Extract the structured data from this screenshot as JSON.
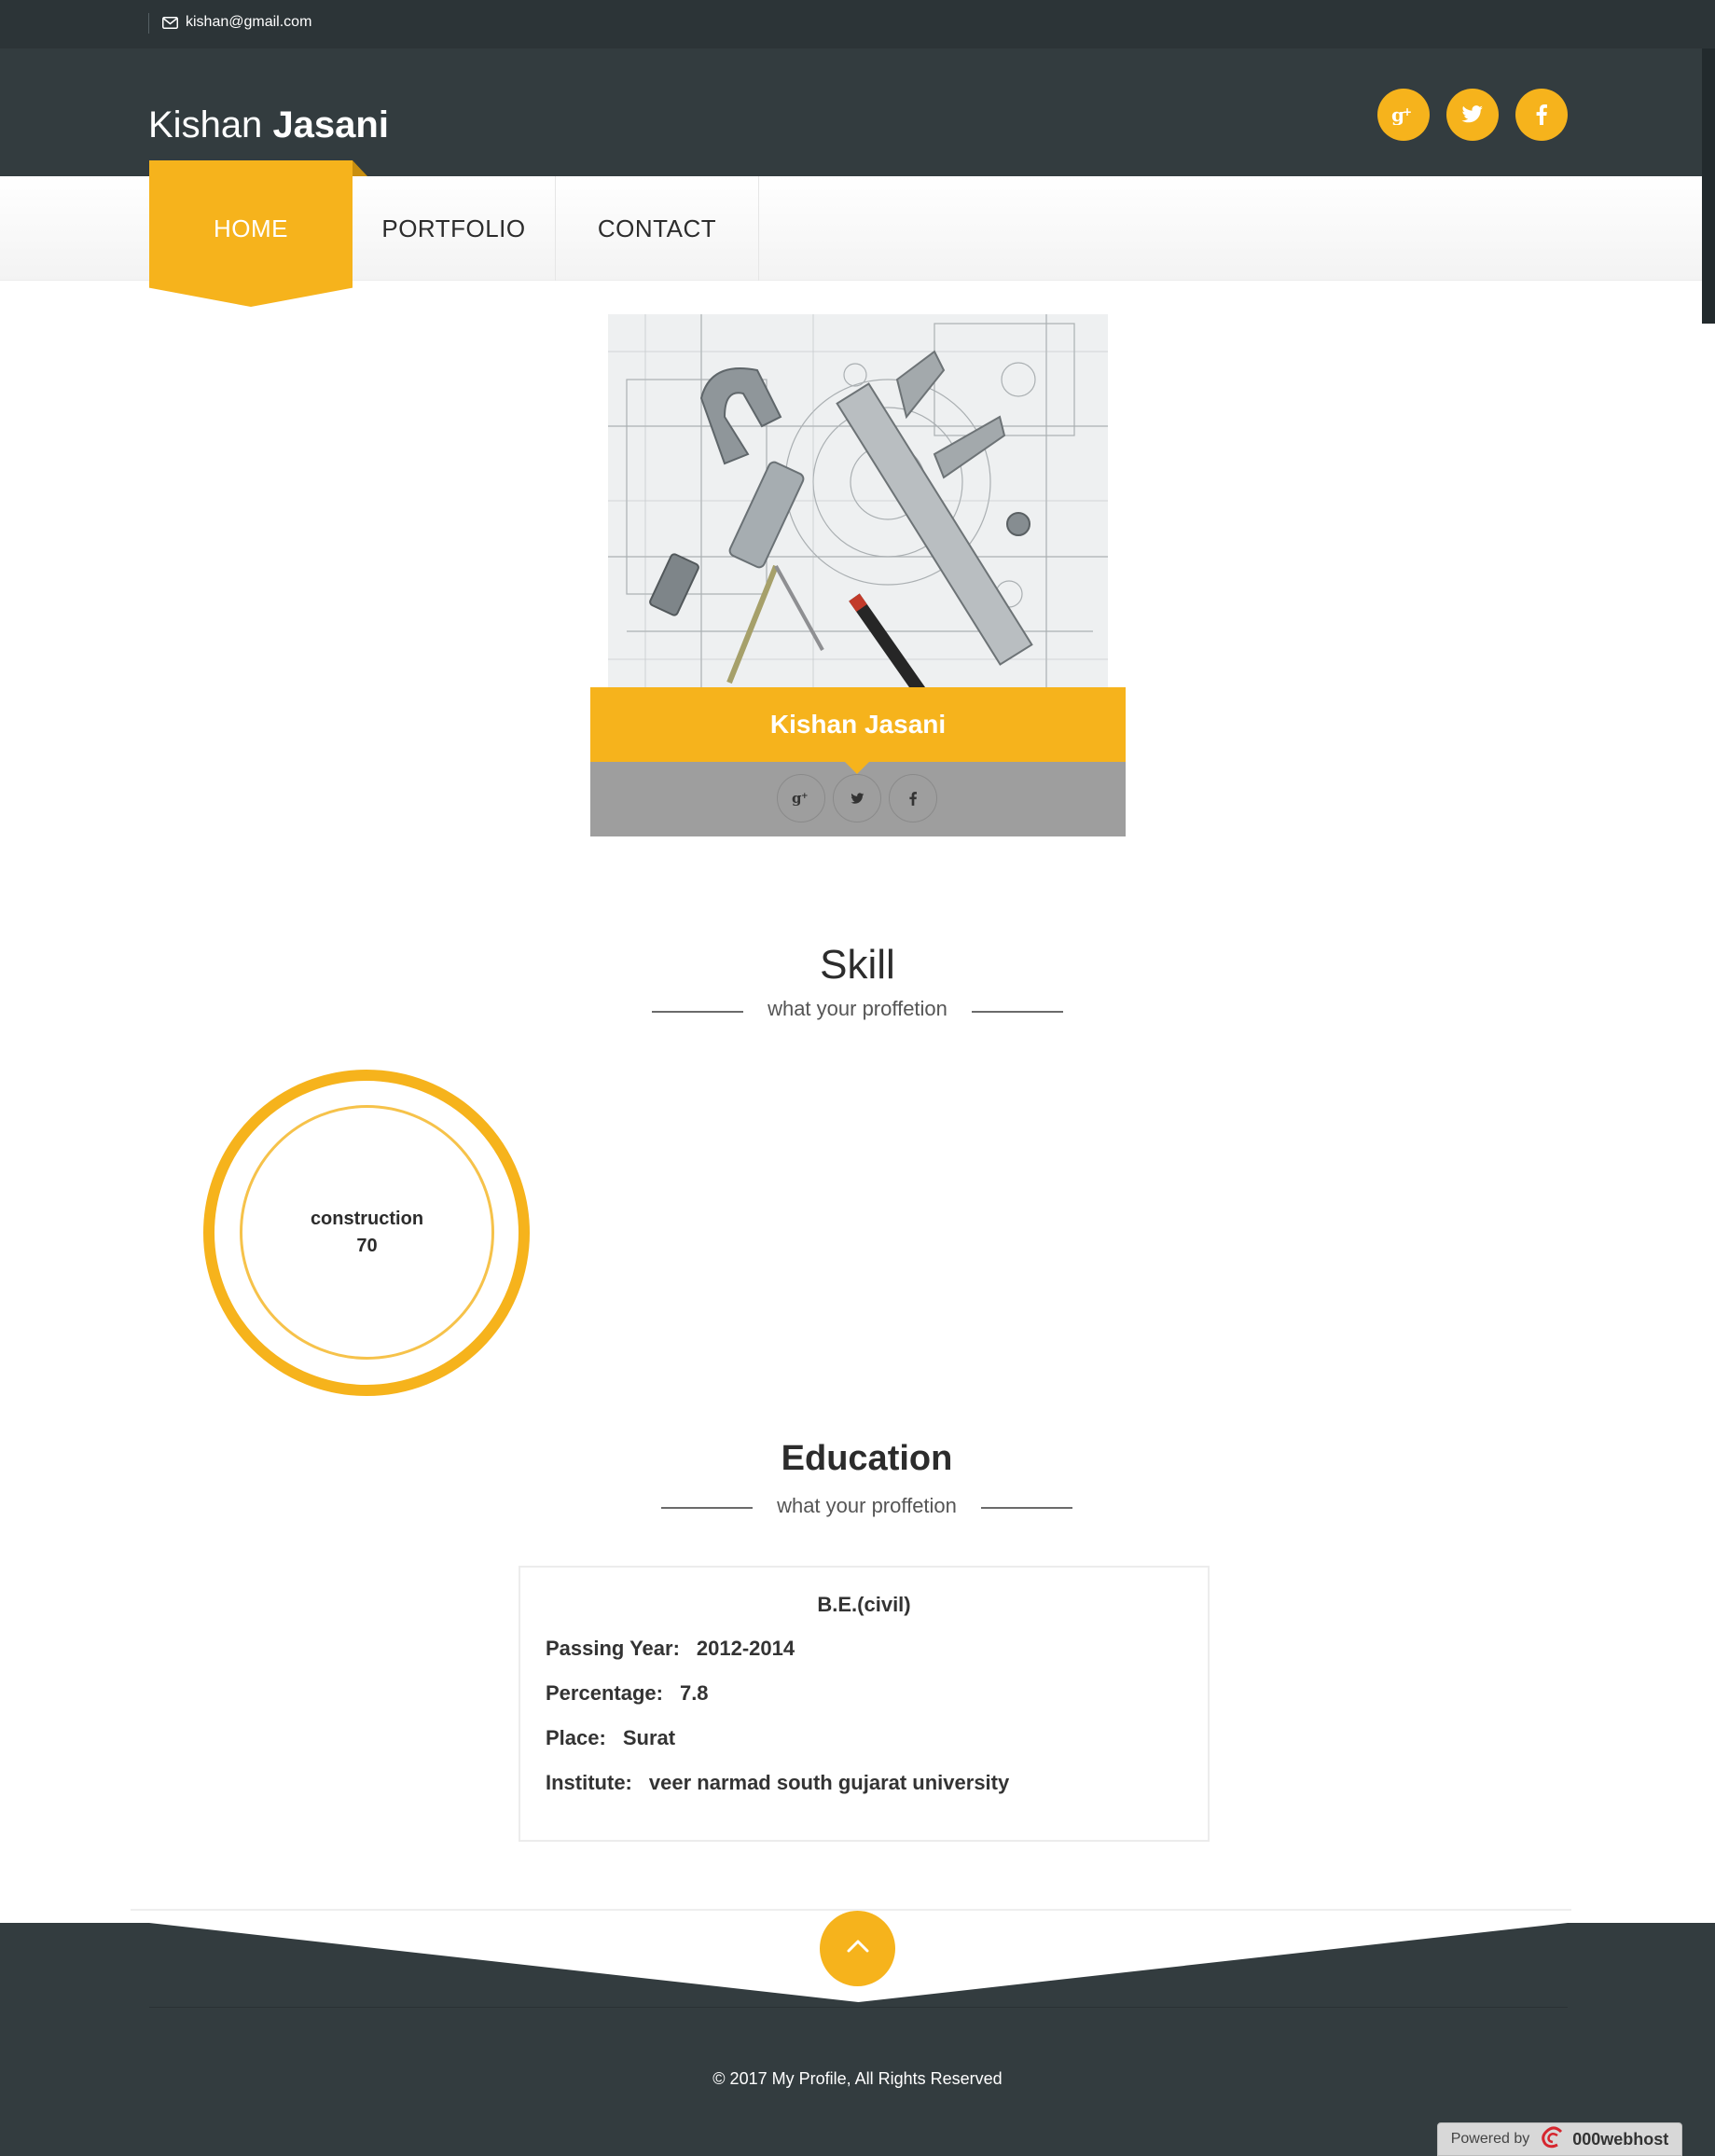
{
  "topbar": {
    "email": "kishan@gmail.com"
  },
  "header": {
    "brand_first": "Kishan",
    "brand_last": "Jasani",
    "social": [
      "google-plus",
      "twitter",
      "facebook"
    ]
  },
  "nav": {
    "items": [
      {
        "label": "HOME",
        "active": true
      },
      {
        "label": "PORTFOLIO"
      },
      {
        "label": "CONTACT"
      }
    ]
  },
  "profile": {
    "name": "Kishan Jasani",
    "social": [
      "google-plus",
      "twitter",
      "facebook"
    ]
  },
  "skill": {
    "title": "Skill",
    "subtitle": "what your proffetion",
    "items": [
      {
        "name": "construction",
        "value": "70"
      }
    ]
  },
  "education": {
    "title": "Education",
    "subtitle": "what your proffetion",
    "degree": "B.E.(civil)",
    "rows": [
      {
        "label": "Passing Year:",
        "value": "2012-2014"
      },
      {
        "label": "Percentage:",
        "value": "7.8"
      },
      {
        "label": "Place:",
        "value": "Surat"
      },
      {
        "label": "Institute:",
        "value": "veer narmad south gujarat university"
      }
    ]
  },
  "footer": {
    "copyright": "© 2017 My Profile, All Rights Reserved",
    "powered_by": "Powered by",
    "host": "000webhost"
  },
  "colors": {
    "accent": "#f6b31c",
    "dark": "#333c3f",
    "topbar": "#2c3437",
    "social_bar": "#9e9e9e"
  }
}
